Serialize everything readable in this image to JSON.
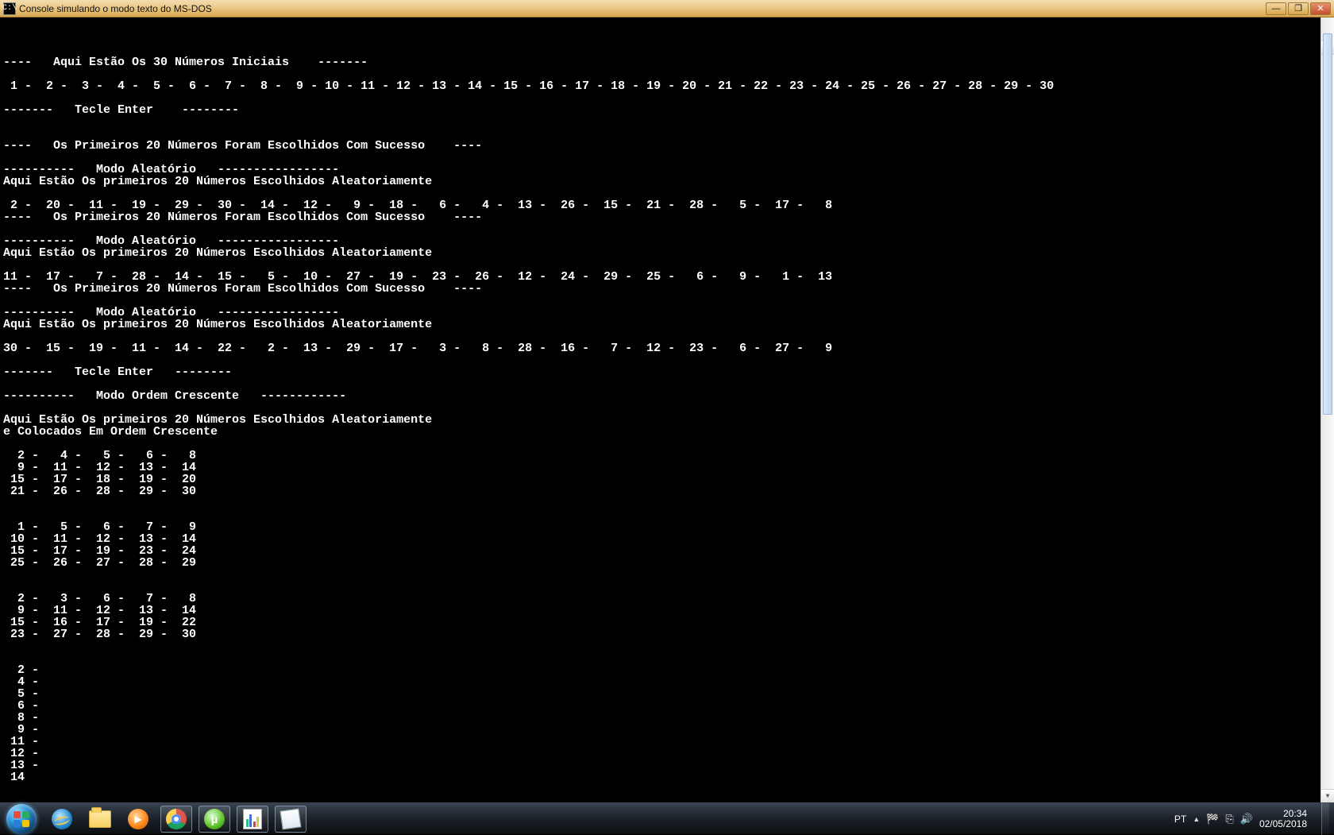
{
  "window": {
    "title": "Console simulando o modo texto do MS-DOS",
    "icon_glyph": "C:\\"
  },
  "win_buttons": {
    "min": "—",
    "max": "❐",
    "close": "✕"
  },
  "console_lines": [
    "",
    "----   Aqui Estão Os 30 Números Iniciais    -------",
    "",
    " 1 -  2 -  3 -  4 -  5 -  6 -  7 -  8 -  9 - 10 - 11 - 12 - 13 - 14 - 15 - 16 - 17 - 18 - 19 - 20 - 21 - 22 - 23 - 24 - 25 - 26 - 27 - 28 - 29 - 30",
    "",
    "-------   Tecle Enter    --------",
    "",
    "",
    "----   Os Primeiros 20 Números Foram Escolhidos Com Sucesso    ----",
    "",
    "----------   Modo Aleatório   -----------------",
    "Aqui Estão Os primeiros 20 Números Escolhidos Aleatoriamente",
    "",
    " 2 -  20 -  11 -  19 -  29 -  30 -  14 -  12 -   9 -  18 -   6 -   4 -  13 -  26 -  15 -  21 -  28 -   5 -  17 -   8",
    "----   Os Primeiros 20 Números Foram Escolhidos Com Sucesso    ----",
    "",
    "----------   Modo Aleatório   -----------------",
    "Aqui Estão Os primeiros 20 Números Escolhidos Aleatoriamente",
    "",
    "11 -  17 -   7 -  28 -  14 -  15 -   5 -  10 -  27 -  19 -  23 -  26 -  12 -  24 -  29 -  25 -   6 -   9 -   1 -  13",
    "----   Os Primeiros 20 Números Foram Escolhidos Com Sucesso    ----",
    "",
    "----------   Modo Aleatório   -----------------",
    "Aqui Estão Os primeiros 20 Números Escolhidos Aleatoriamente",
    "",
    "30 -  15 -  19 -  11 -  14 -  22 -   2 -  13 -  29 -  17 -   3 -   8 -  28 -  16 -   7 -  12 -  23 -   6 -  27 -   9",
    "",
    "-------   Tecle Enter   --------",
    "",
    "----------   Modo Ordem Crescente   ------------",
    "",
    "Aqui Estão Os primeiros 20 Números Escolhidos Aleatoriamente",
    "e Colocados Em Ordem Crescente",
    "",
    "  2 -   4 -   5 -   6 -   8",
    "  9 -  11 -  12 -  13 -  14",
    " 15 -  17 -  18 -  19 -  20",
    " 21 -  26 -  28 -  29 -  30",
    "",
    "",
    "  1 -   5 -   6 -   7 -   9",
    " 10 -  11 -  12 -  13 -  14",
    " 15 -  17 -  19 -  23 -  24",
    " 25 -  26 -  27 -  28 -  29",
    "",
    "",
    "  2 -   3 -   6 -   7 -   8",
    "  9 -  11 -  12 -  13 -  14",
    " 15 -  16 -  17 -  19 -  22",
    " 23 -  27 -  28 -  29 -  30",
    "",
    "",
    "  2 -",
    "  4 -",
    "  5 -",
    "  6 -",
    "  8 -",
    "  9 -",
    " 11 -",
    " 12 -",
    " 13 -",
    " 14"
  ],
  "taskbar": {
    "pins": [
      {
        "name": "ie",
        "active": false
      },
      {
        "name": "explorer",
        "active": false
      },
      {
        "name": "wmp",
        "active": false
      },
      {
        "name": "chrome",
        "active": true
      },
      {
        "name": "utorrent",
        "active": true
      },
      {
        "name": "devcpp",
        "active": true
      },
      {
        "name": "notepad",
        "active": true
      }
    ],
    "tray": {
      "lang": "PT",
      "caret": "▲",
      "flag": "🏁",
      "action": "⎘",
      "sound": "🔊"
    },
    "clock": {
      "time": "20:34",
      "date": "02/05/2018"
    }
  }
}
